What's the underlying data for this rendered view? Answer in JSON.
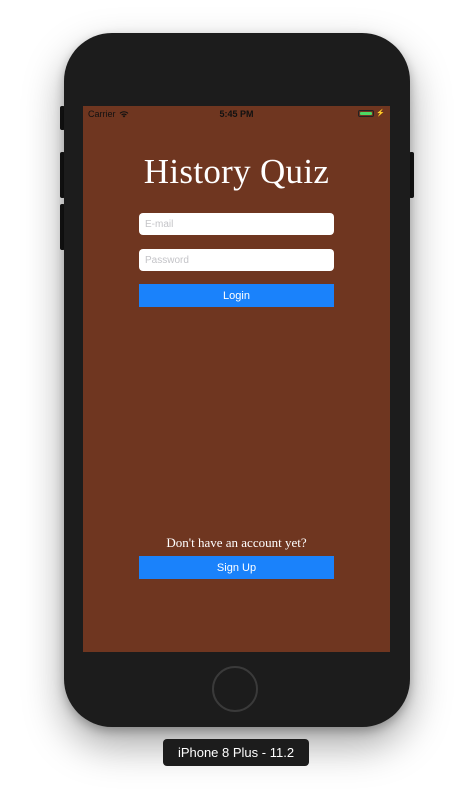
{
  "statusbar": {
    "carrier": "Carrier",
    "time": "5:45 PM",
    "wifi_icon": "wifi-icon",
    "battery_icon": "battery-icon",
    "charging_icon": "bolt-icon",
    "battery_level": 1.0,
    "charging_symbol": "⚡"
  },
  "app": {
    "title": "History Quiz",
    "email_placeholder": "E-mail",
    "password_placeholder": "Password",
    "login_label": "Login",
    "signup_prompt": "Don't have an account yet?",
    "signup_label": "Sign Up",
    "background_color": "#6f3620",
    "button_color": "#1a82fb"
  },
  "simulator": {
    "device_label": "iPhone 8 Plus - 11.2"
  }
}
